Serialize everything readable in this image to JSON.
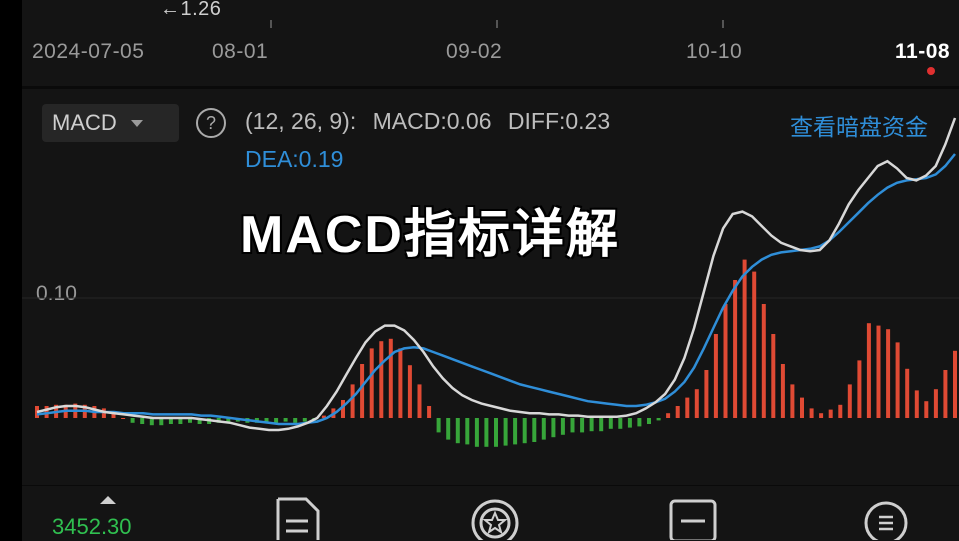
{
  "top_chart": {
    "price_annotation": "←1.26",
    "dates": [
      "2024-07-05",
      "08-01",
      "09-02",
      "10-10",
      "11-08"
    ]
  },
  "indicator": {
    "selector_label": "MACD",
    "params_label": "(12, 26, 9):",
    "macd_text": "MACD:0.06",
    "diff_text": "DIFF:0.23",
    "dea_text": "DEA:0.19",
    "link_text": "查看暗盘资金",
    "y_tick": "0.10"
  },
  "overlay_title": "MACD指标详解",
  "colors": {
    "diff_line": "#d8d8d8",
    "dea_line": "#2f8ed8",
    "bar_pos": "#e04a34",
    "bar_neg": "#37a63a",
    "accent_blue": "#2f8ed8"
  },
  "chart_data": {
    "type": "bar",
    "zero_line_value": 0,
    "ylim": [
      -0.05,
      0.22
    ],
    "tick_values": [
      0.1
    ],
    "histogram": [
      0.01,
      0.01,
      0.011,
      0.011,
      0.012,
      0.011,
      0.01,
      0.008,
      0.004,
      0.0,
      -0.004,
      -0.005,
      -0.006,
      -0.006,
      -0.005,
      -0.005,
      -0.004,
      -0.005,
      -0.005,
      -0.004,
      -0.004,
      -0.003,
      -0.004,
      -0.004,
      -0.004,
      -0.004,
      -0.003,
      -0.004,
      -0.003,
      -0.002,
      0.002,
      0.008,
      0.015,
      0.028,
      0.045,
      0.058,
      0.064,
      0.066,
      0.058,
      0.044,
      0.028,
      0.01,
      -0.012,
      -0.018,
      -0.021,
      -0.022,
      -0.024,
      -0.024,
      -0.024,
      -0.023,
      -0.022,
      -0.021,
      -0.02,
      -0.018,
      -0.016,
      -0.014,
      -0.012,
      -0.012,
      -0.011,
      -0.011,
      -0.009,
      -0.009,
      -0.008,
      -0.007,
      -0.005,
      -0.002,
      0.004,
      0.01,
      0.017,
      0.024,
      0.04,
      0.07,
      0.095,
      0.115,
      0.132,
      0.122,
      0.095,
      0.07,
      0.045,
      0.028,
      0.017,
      0.008,
      0.004,
      0.007,
      0.011,
      0.028,
      0.048,
      0.079,
      0.077,
      0.074,
      0.063,
      0.041,
      0.023,
      0.014,
      0.024,
      0.04,
      0.056
    ],
    "diff": [
      0.005,
      0.007,
      0.009,
      0.01,
      0.01,
      0.009,
      0.007,
      0.005,
      0.004,
      0.003,
      0.002,
      0.001,
      0.0,
      0.0,
      0.0,
      0.0,
      0.0,
      -0.001,
      -0.002,
      -0.003,
      -0.004,
      -0.006,
      -0.008,
      -0.009,
      -0.01,
      -0.01,
      -0.009,
      -0.007,
      -0.004,
      0.0,
      0.01,
      0.022,
      0.036,
      0.05,
      0.063,
      0.072,
      0.077,
      0.077,
      0.073,
      0.065,
      0.055,
      0.043,
      0.033,
      0.025,
      0.019,
      0.015,
      0.012,
      0.01,
      0.008,
      0.006,
      0.005,
      0.004,
      0.004,
      0.003,
      0.003,
      0.002,
      0.002,
      0.001,
      0.001,
      0.001,
      0.001,
      0.002,
      0.004,
      0.008,
      0.013,
      0.02,
      0.032,
      0.05,
      0.075,
      0.105,
      0.135,
      0.158,
      0.17,
      0.172,
      0.168,
      0.16,
      0.152,
      0.146,
      0.143,
      0.14,
      0.139,
      0.14,
      0.148,
      0.162,
      0.178,
      0.19,
      0.2,
      0.21,
      0.214,
      0.208,
      0.2,
      0.198,
      0.202,
      0.21,
      0.228,
      0.25
    ],
    "dea": [
      0.003,
      0.004,
      0.005,
      0.006,
      0.006,
      0.006,
      0.005,
      0.005,
      0.005,
      0.004,
      0.004,
      0.004,
      0.003,
      0.003,
      0.003,
      0.003,
      0.003,
      0.002,
      0.002,
      0.001,
      0.0,
      -0.001,
      -0.002,
      -0.003,
      -0.004,
      -0.005,
      -0.005,
      -0.005,
      -0.004,
      -0.003,
      0.0,
      0.005,
      0.012,
      0.02,
      0.03,
      0.04,
      0.048,
      0.055,
      0.058,
      0.059,
      0.058,
      0.055,
      0.052,
      0.049,
      0.046,
      0.043,
      0.04,
      0.037,
      0.034,
      0.031,
      0.028,
      0.026,
      0.024,
      0.022,
      0.02,
      0.018,
      0.016,
      0.014,
      0.013,
      0.012,
      0.011,
      0.01,
      0.01,
      0.011,
      0.013,
      0.016,
      0.022,
      0.03,
      0.042,
      0.058,
      0.075,
      0.092,
      0.106,
      0.118,
      0.126,
      0.132,
      0.136,
      0.138,
      0.139,
      0.14,
      0.141,
      0.143,
      0.148,
      0.155,
      0.163,
      0.171,
      0.179,
      0.186,
      0.192,
      0.196,
      0.198,
      0.199,
      0.2,
      0.203,
      0.21,
      0.22
    ]
  },
  "bottom_nav": {
    "index_value": "3452.30"
  }
}
